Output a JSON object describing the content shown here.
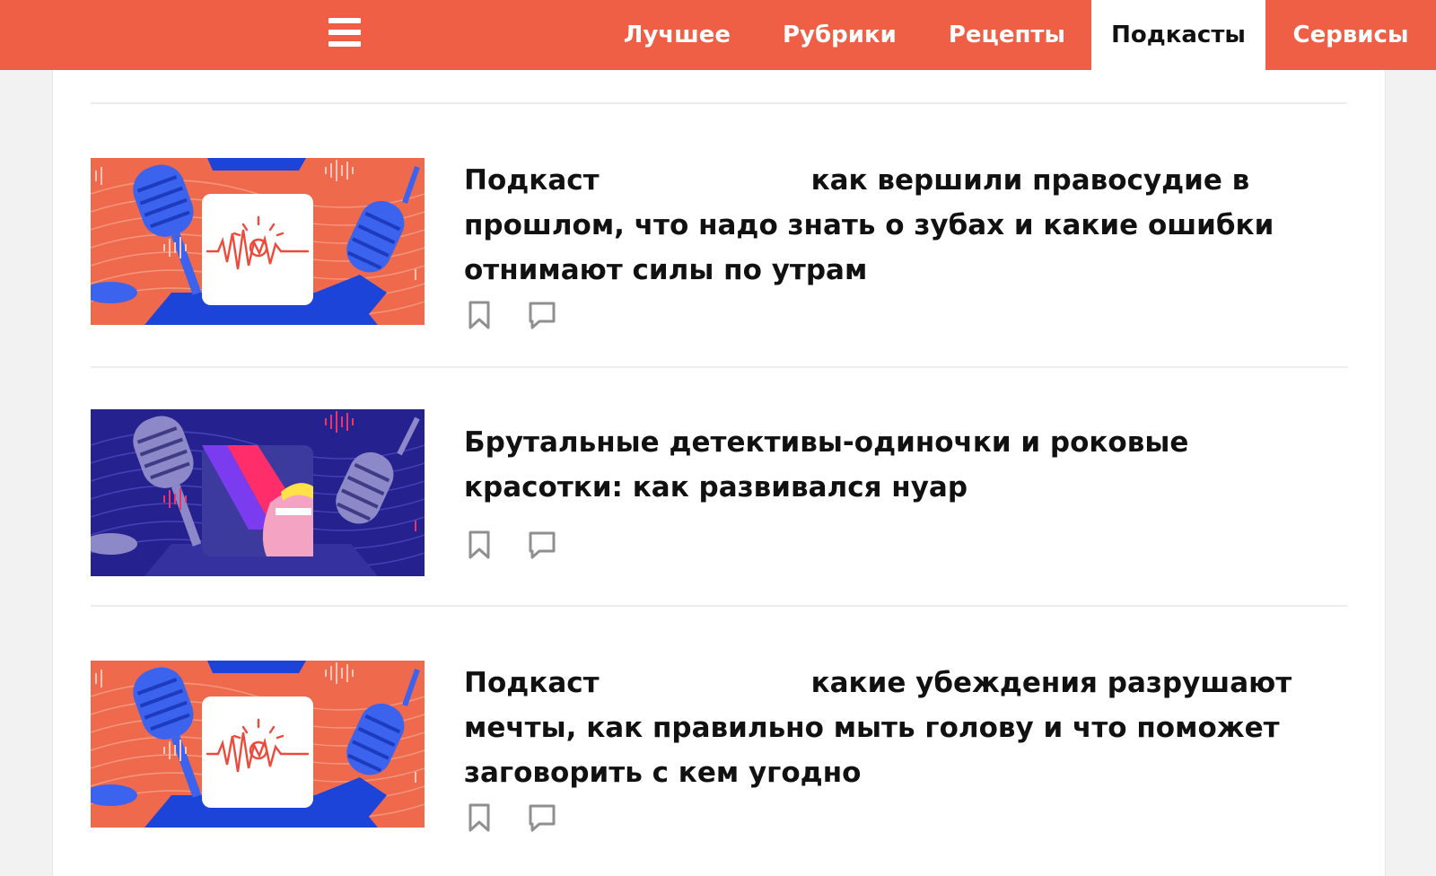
{
  "header": {
    "menu_icon": "hamburger-menu-icon",
    "nav": [
      {
        "label": "Лучшее",
        "active": false
      },
      {
        "label": "Рубрики",
        "active": false
      },
      {
        "label": "Рецепты",
        "active": false
      },
      {
        "label": "Подкасты",
        "active": true
      },
      {
        "label": "Сервисы",
        "active": false
      }
    ],
    "brand_color": "#ee5f45"
  },
  "articles": [
    {
      "title_start": "Подкаст",
      "title_rest": "как вершили правосудие в прошлом, что надо знать о зубах и какие ошибки отнимают силы по утрам",
      "thumbnail": "orange-podcast-cover",
      "actions": [
        "bookmark-icon",
        "comment-icon"
      ]
    },
    {
      "title": "Брутальные детективы-одиночки и роковые красотки: как развивался нуар",
      "thumbnail": "purple-noir-cover",
      "actions": [
        "bookmark-icon",
        "comment-icon"
      ]
    },
    {
      "title_start": "Подкаст",
      "title_rest": "какие убеждения разрушают мечты, как правильно мыть голову и что поможет заговорить с кем угодно",
      "thumbnail": "orange-podcast-cover",
      "actions": [
        "bookmark-icon",
        "comment-icon"
      ]
    }
  ]
}
